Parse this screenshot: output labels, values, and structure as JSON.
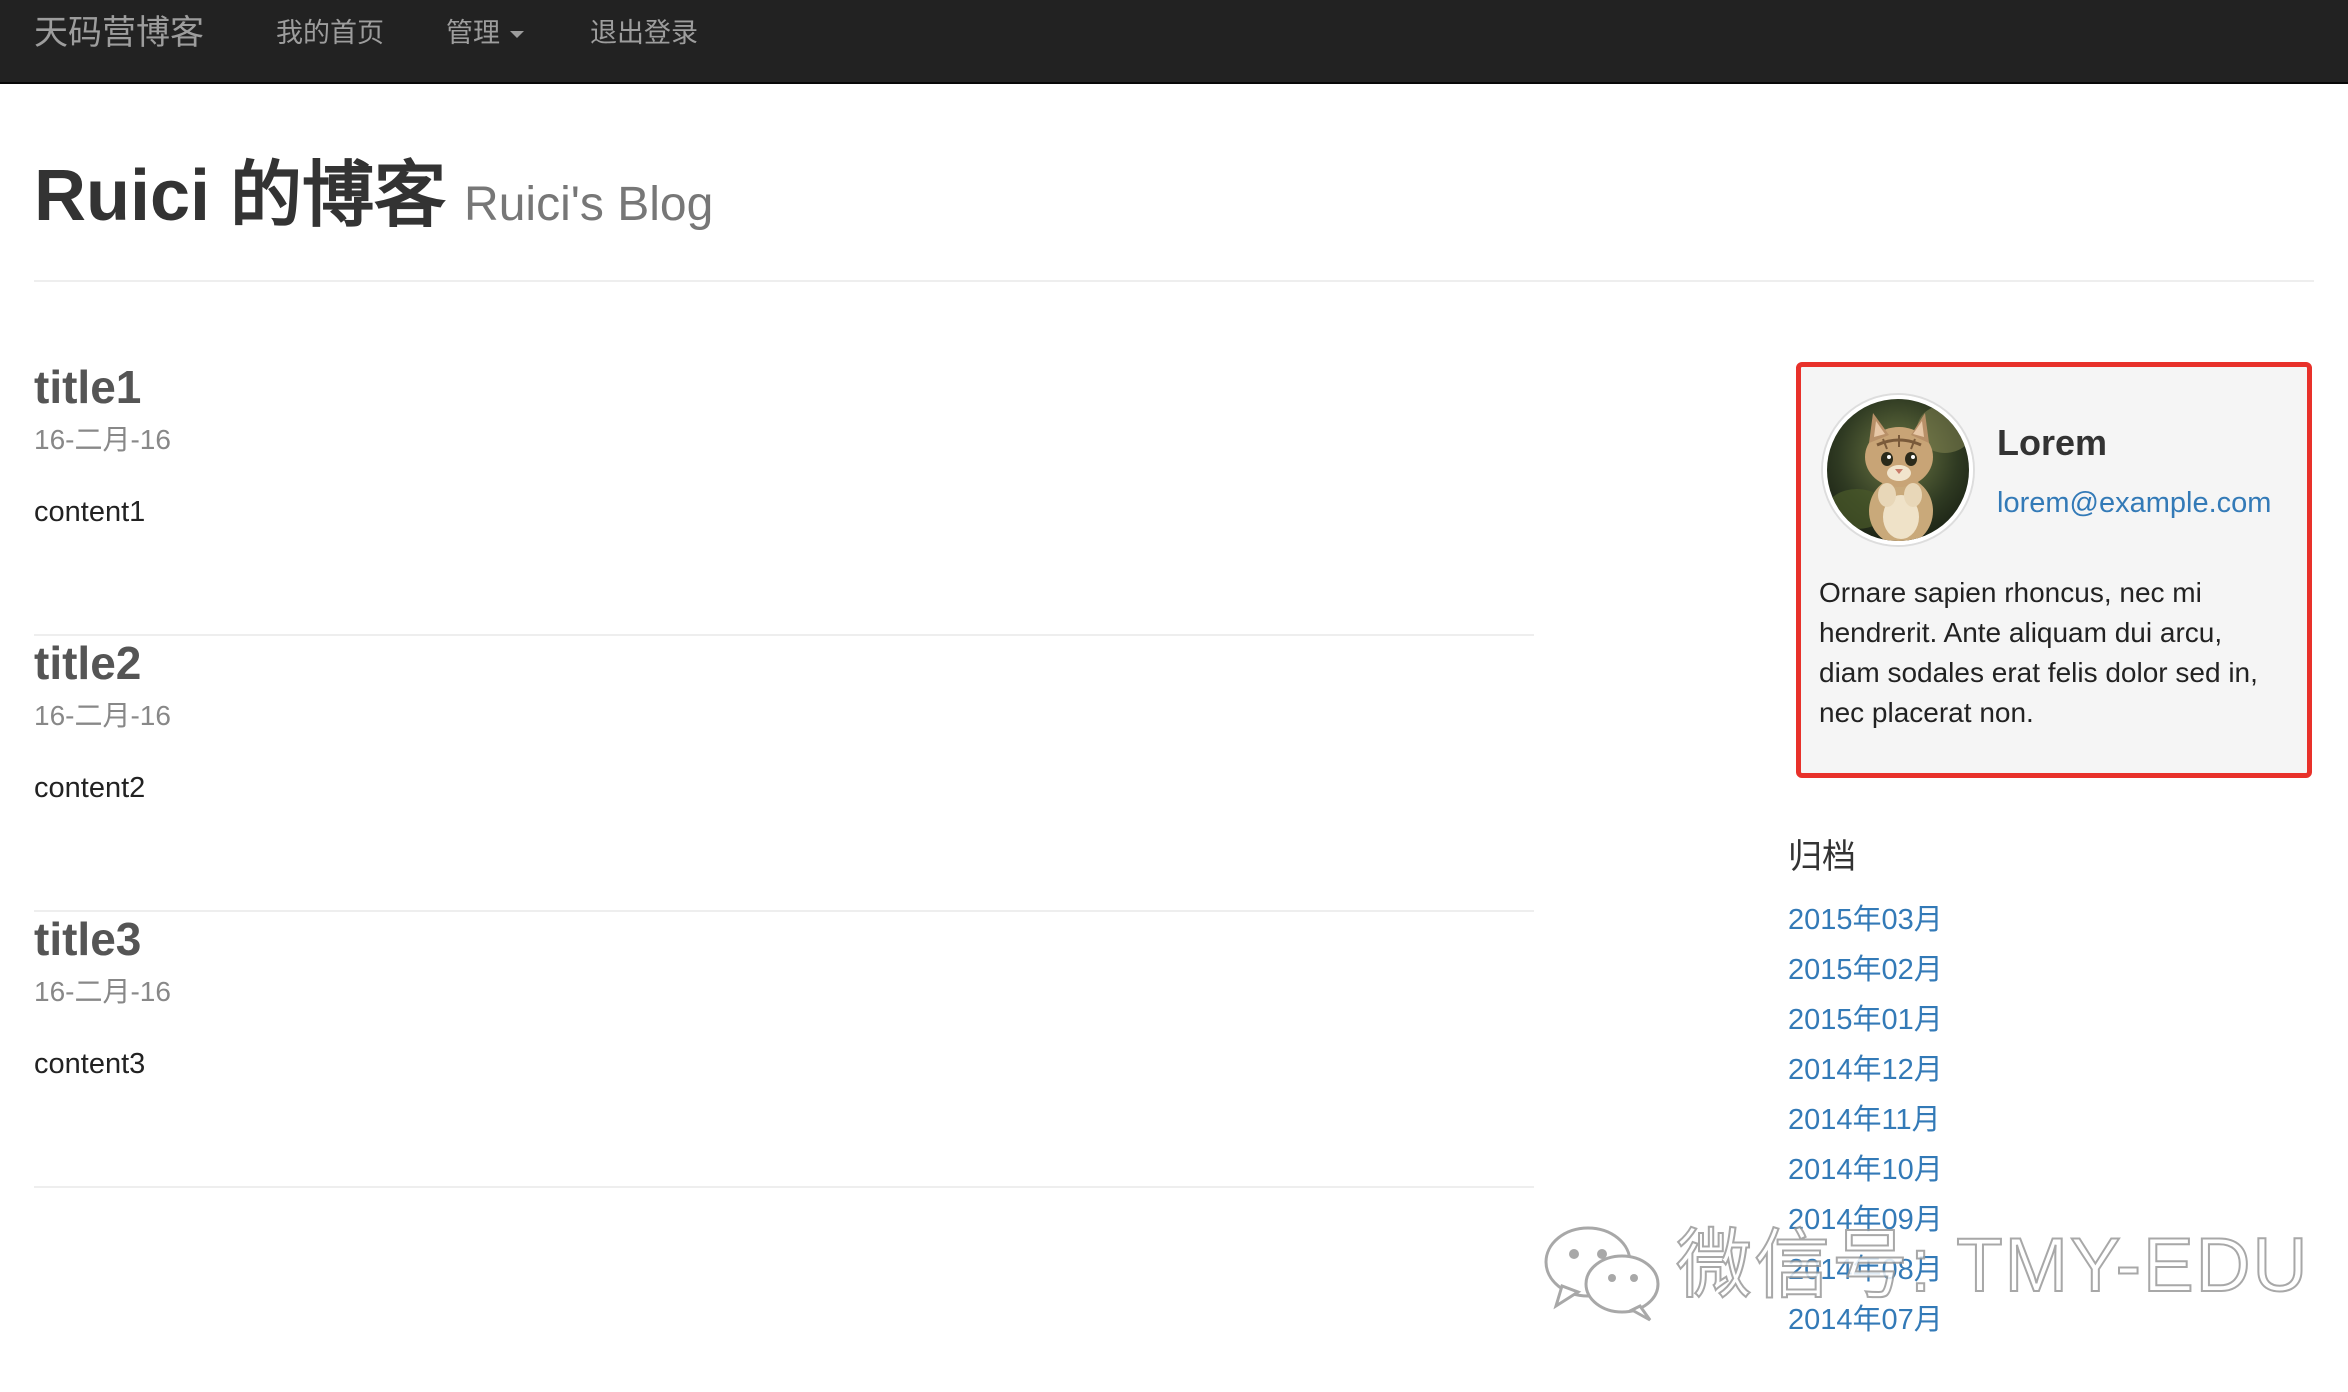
{
  "navbar": {
    "brand": "天码营博客",
    "home": "我的首页",
    "manage": "管理",
    "logout": "退出登录"
  },
  "header": {
    "title": "Ruici 的博客",
    "subtitle": "Ruici's Blog"
  },
  "posts": [
    {
      "title": "title1",
      "date": "16-二月-16",
      "content": "content1"
    },
    {
      "title": "title2",
      "date": "16-二月-16",
      "content": "content2"
    },
    {
      "title": "title3",
      "date": "16-二月-16",
      "content": "content3"
    }
  ],
  "profile": {
    "name": "Lorem",
    "email": "lorem@example.com",
    "bio": "Ornare sapien rhoncus, nec mi hendrerit. Ante aliquam dui arcu, diam sodales erat felis dolor sed in, nec placerat non.",
    "highlight_color": "#e8312a"
  },
  "archive": {
    "title": "归档",
    "items": [
      "2015年03月",
      "2015年02月",
      "2015年01月",
      "2014年12月",
      "2014年11月",
      "2014年10月",
      "2014年09月",
      "2014年08月",
      "2014年07月"
    ]
  },
  "watermark": {
    "icon": "wechat-icon",
    "text": "微信号: TMY-EDU"
  },
  "colors": {
    "navbar_bg": "#222222",
    "link": "#337ab7",
    "muted": "#777777"
  }
}
